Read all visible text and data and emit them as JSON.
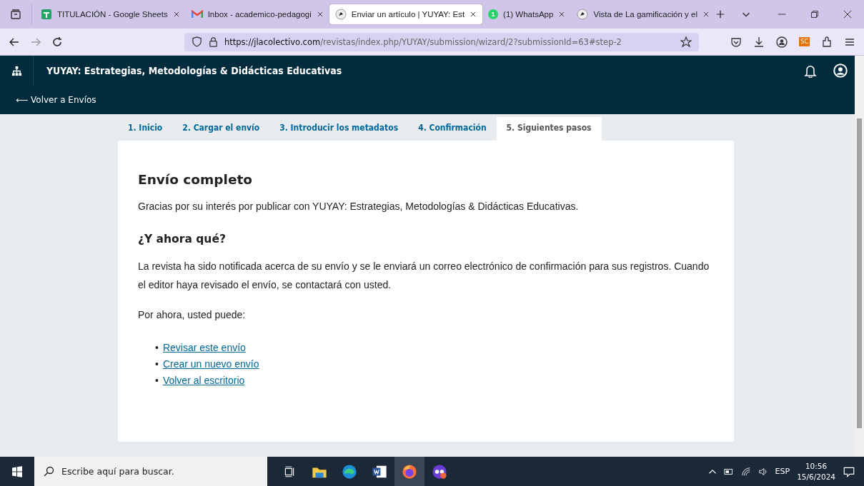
{
  "browser_tabs": [
    {
      "title": "TITULACIÓN - Google Sheets",
      "kind": "sheets",
      "selected": false
    },
    {
      "title": "Inbox - academico-pedagogi",
      "kind": "mail",
      "selected": false
    },
    {
      "title": "Enviar un artículo | YUYAY: Est",
      "kind": "journal",
      "selected": true
    },
    {
      "title": "(1) WhatsApp",
      "kind": "whatsapp",
      "badge": "1",
      "selected": false
    },
    {
      "title": "Vista de La gamificación y el",
      "kind": "journal",
      "selected": false
    }
  ],
  "address_bar": {
    "url_host": "https://jlacolectivo.com",
    "url_path": "/revistas/index.php/YUYAY/submission/wizard/2?submissionId=63#step-2"
  },
  "extension_badge": "SC",
  "site": {
    "title": "YUYAY: Estrategias, Metodologías & Didácticas Educativas",
    "back_link": "⟵ Volver a Envíos"
  },
  "steps": [
    {
      "label": "1. Inicio",
      "selected": false
    },
    {
      "label": "2. Cargar el envío",
      "selected": false
    },
    {
      "label": "3. Introducir los metadatos",
      "selected": false
    },
    {
      "label": "4. Confirmación",
      "selected": false
    },
    {
      "label": "5. Siguientes pasos",
      "selected": true
    }
  ],
  "content": {
    "heading": "Envío completo",
    "thanks": "Gracias por su interés por publicar con YUYAY: Estrategias, Metodologías & Didácticas Educativas.",
    "subheading": "¿Y ahora qué?",
    "paragraphs": [
      "La revista ha sido notificada acerca de su envío y se le enviará un correo electrónico de confirmación para sus registros. Cuando el editor haya revisado el envío, se contactará con usted.",
      "Por ahora, usted puede:"
    ],
    "bullet": "•",
    "links": [
      "Revisar este envío",
      "Crear un nuevo envío",
      "Volver al escritorio"
    ]
  },
  "taskbar": {
    "search_placeholder": "Escribe aquí para buscar.",
    "apps": [
      {
        "kind": "taskview",
        "selected": false
      },
      {
        "kind": "folder",
        "selected": false
      },
      {
        "kind": "edge",
        "selected": false
      },
      {
        "kind": "word",
        "selected": false
      },
      {
        "kind": "firefox",
        "selected": true
      },
      {
        "kind": "extra",
        "selected": false
      }
    ],
    "language": "ESP",
    "time": "10:56",
    "date": "15/6/2024"
  }
}
